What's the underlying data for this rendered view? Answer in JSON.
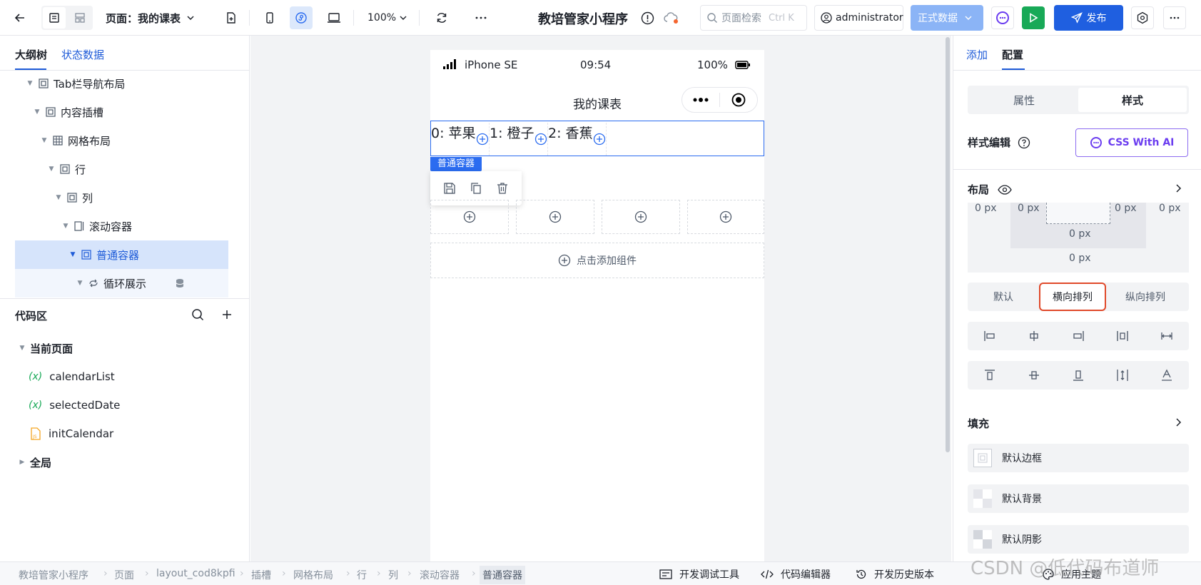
{
  "topbar": {
    "page_label": "页面：我的课表",
    "zoom": "100%",
    "app_title": "教培管家小程序",
    "search_placeholder": "页面检索",
    "search_shortcut": "Ctrl K",
    "user": "administrator",
    "env": "正式数据",
    "publish": "发布"
  },
  "left": {
    "tabs": [
      "大纲树",
      "状态数据"
    ],
    "tree": [
      {
        "label": "Tab栏导航布局"
      },
      {
        "label": "内容插槽"
      },
      {
        "label": "网格布局"
      },
      {
        "label": "行"
      },
      {
        "label": "列"
      },
      {
        "label": "滚动容器"
      },
      {
        "label": "普通容器"
      },
      {
        "label": "循环展示"
      }
    ],
    "code_title": "代码区",
    "current_page": "当前页面",
    "vars": [
      {
        "label": "calendarList",
        "type": "(x)"
      },
      {
        "label": "selectedDate",
        "type": "(x)"
      },
      {
        "label": "initCalendar",
        "type": "js"
      }
    ],
    "global": "全局"
  },
  "phone": {
    "carrier": "iPhone SE",
    "time": "09:54",
    "battery": "100%",
    "title": "我的课表",
    "items": [
      "0: 苹果",
      "1: 橙子",
      "2: 香蕉"
    ],
    "container_tag": "普通容器",
    "add_component": "点击添加组件"
  },
  "right": {
    "tabs": [
      "添加",
      "配置"
    ],
    "segs": [
      "属性",
      "样式"
    ],
    "style_edit": "样式编辑",
    "css_ai": "CSS With AI",
    "layout": "布局",
    "px": {
      "a": "0 px",
      "b": "0 px",
      "c": "0 px",
      "d": "0 px",
      "e": "0 px",
      "f": "0 px"
    },
    "direction": [
      "默认",
      "横向排列",
      "纵向排列"
    ],
    "fill": "填充",
    "fills": [
      "默认边框",
      "默认背景",
      "默认阴影"
    ]
  },
  "bottom": {
    "crumbs": [
      "教培管家小程序",
      "页面",
      "layout_cod8kpfi",
      "插槽",
      "网格布局",
      "行",
      "列",
      "滚动容器",
      "普通容器"
    ],
    "debug": "开发调试工具",
    "editor": "代码编辑器",
    "history": "开发历史版本",
    "theme": "应用主题",
    "watermark": "CSDN @低代码布道师"
  }
}
